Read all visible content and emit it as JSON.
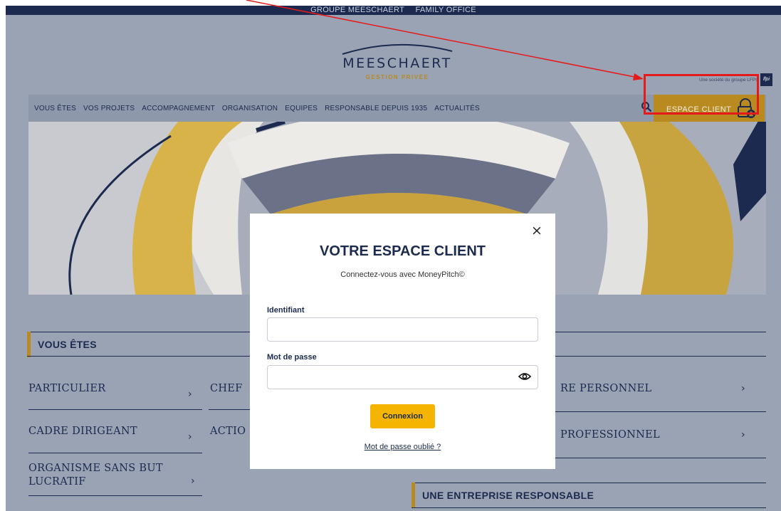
{
  "topbar": {
    "group": "GROUPE MEESCHAERT",
    "family": "FAMILY OFFICE"
  },
  "logo": {
    "name": "MEESCHAERT",
    "sub": "GESTION PRIVÉE"
  },
  "lfpi": {
    "text": "Une société du groupe LFPI",
    "badge": "lfpi"
  },
  "nav": {
    "items": [
      "VOUS ÊTES",
      "VOS PROJETS",
      "ACCOMPAGNEMENT",
      "ORGANISATION",
      "EQUIPES",
      "RESPONSABLE DEPUIS 1935",
      "ACTUALITÉS"
    ],
    "espace_client": "ESPACE CLIENT"
  },
  "sections": {
    "vous_etes": "VOUS ÊTES",
    "entreprise": "UNE ENTREPRISE RESPONSABLE"
  },
  "profiles": {
    "col1": [
      "PARTICULIER",
      "CADRE DIRIGEANT",
      "ORGANISME SANS BUT LUCRATIF"
    ],
    "col2": [
      "CHEF",
      "ACTIO"
    ],
    "col3": [
      "RE PERSONNEL",
      "PROFESSIONNEL"
    ]
  },
  "modal": {
    "close": "×",
    "title": "VOTRE ESPACE CLIENT",
    "subtitle": "Connectez-vous avec MoneyPitch©",
    "login_label": "Identifiant",
    "login_value": "",
    "password_label": "Mot de passe",
    "password_value": "",
    "submit": "Connexion",
    "forgot": "Mot de passe oublié ?"
  },
  "colors": {
    "navy": "#1b2a4e",
    "gold": "#b88a1f",
    "button": "#f5b400",
    "annotation": "#e51b1b"
  }
}
